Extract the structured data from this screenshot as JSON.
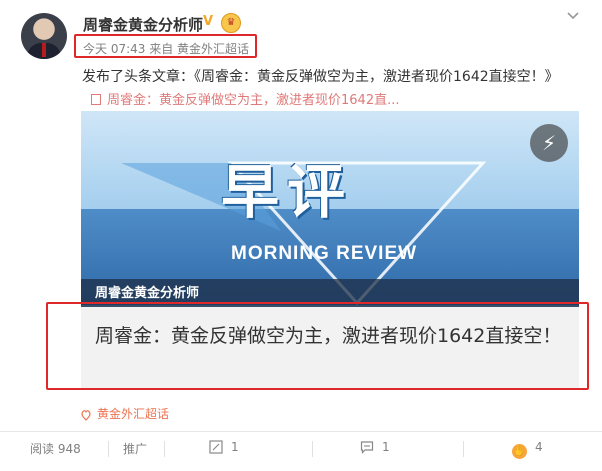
{
  "post": {
    "author": "周睿金黄金分析师",
    "meta": "今天 07:43 来自 黄金外汇超话",
    "text": "发布了头条文章：《周睿金：黄金反弹做空为主，激进者现价1642直接空！》",
    "link_text": "周睿金：黄金反弹做空为主，激进者现价1642直..."
  },
  "card": {
    "banner_title": "早评",
    "banner_subtitle": "MORNING REVIEW",
    "caption": "周睿金黄金分析师",
    "article_title": "周睿金：黄金反弹做空为主，激进者现价1642直接空！"
  },
  "topic": "黄金外汇超话",
  "footer": {
    "read": "阅读 948",
    "promote": "推广",
    "repost": "1",
    "comment": "1",
    "like": "4"
  },
  "colors": {
    "highlight_box": "#e02828",
    "link": "#e07a7a",
    "topic": "#eb7350",
    "badge": "#f5a623"
  },
  "icons": [
    "vip-badge-icon",
    "crown-icon",
    "chevron-down-icon",
    "document-icon",
    "lightning-icon",
    "topic-icon",
    "repost-icon",
    "comment-icon",
    "like-icon"
  ]
}
